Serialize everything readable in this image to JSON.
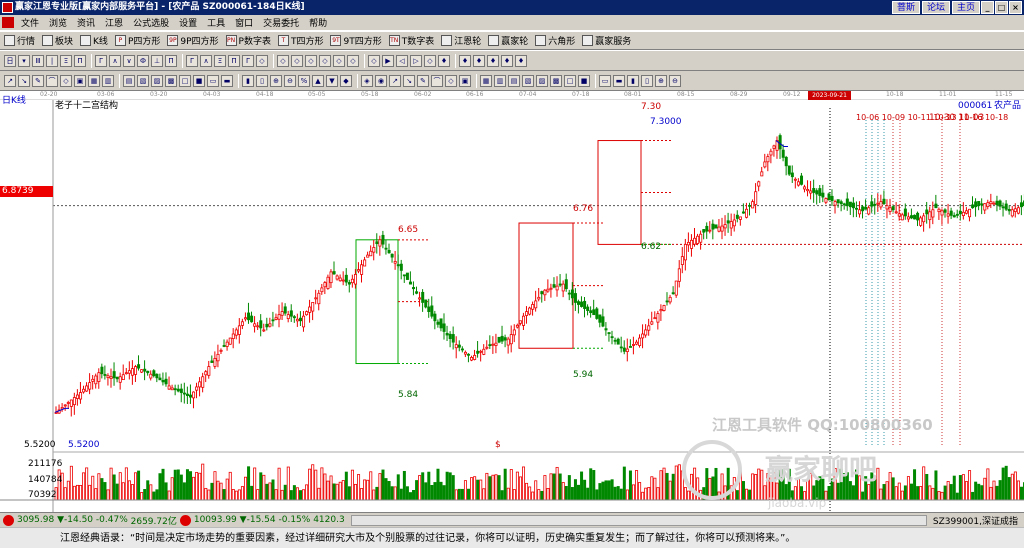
{
  "window": {
    "title": "赢家江恩专业版[赢家内部服务平台] - [农产品  SZ000061-184日K线]",
    "links": [
      "菩斯",
      "论坛",
      "主页"
    ]
  },
  "menu": [
    "文件",
    "浏览",
    "资讯",
    "江恩",
    "公式选股",
    "设置",
    "工具",
    "窗口",
    "交易委托",
    "帮助"
  ],
  "toolbar1": [
    {
      "icon": "list-icon",
      "label": "行情"
    },
    {
      "icon": "block-icon",
      "label": "板块"
    },
    {
      "icon": "kline-icon",
      "label": "K线"
    },
    {
      "icon": "P",
      "label": "P四方形"
    },
    {
      "icon": "9P",
      "label": "9P四方形"
    },
    {
      "icon": "PN",
      "label": "P数字表"
    },
    {
      "icon": "T",
      "label": "T四方形"
    },
    {
      "icon": "9T",
      "label": "9T四方形"
    },
    {
      "icon": "TN",
      "label": "T数字表"
    },
    {
      "icon": "wheel-icon",
      "label": "江恩轮"
    },
    {
      "icon": "wheel2-icon",
      "label": "赢家轮"
    },
    {
      "icon": "hex-icon",
      "label": "六角形"
    },
    {
      "icon": "service-icon",
      "label": "赢家服务"
    }
  ],
  "dates": [
    {
      "x": 40,
      "t": "02-20"
    },
    {
      "x": 97,
      "t": "03-06"
    },
    {
      "x": 150,
      "t": "03-20"
    },
    {
      "x": 203,
      "t": "04-03"
    },
    {
      "x": 256,
      "t": "04-18"
    },
    {
      "x": 308,
      "t": "05-05"
    },
    {
      "x": 361,
      "t": "05-18"
    },
    {
      "x": 414,
      "t": "06-02"
    },
    {
      "x": 466,
      "t": "06-16"
    },
    {
      "x": 519,
      "t": "07-04"
    },
    {
      "x": 572,
      "t": "07-18"
    },
    {
      "x": 624,
      "t": "08-01"
    },
    {
      "x": 677,
      "t": "08-15"
    },
    {
      "x": 730,
      "t": "08-29"
    },
    {
      "x": 783,
      "t": "09-12"
    },
    {
      "x": 886,
      "t": "10-18"
    },
    {
      "x": 939,
      "t": "11-01"
    },
    {
      "x": 995,
      "t": "11-15"
    }
  ],
  "highlight_date": "2023-09-21",
  "chart_labels": {
    "period": "日K线",
    "structure": "老子十二宫结构",
    "code": "000061",
    "name": "农产品",
    "price_box": "6.8739",
    "ytick": "5.5200",
    "low_marker": "5.5200",
    "peak_marker": "7.3000",
    "box1_top": "6.65",
    "box1_bot": "5.84",
    "box2_top": "6.76",
    "box2_bot": "5.94",
    "box3_top": "7.30",
    "box3_bot": "6.62",
    "future_dates": "10-06 10-09 10-11 10-13 10-16 10-18",
    "future_dates2": "10-30 11-03",
    "dollar_mark": "$",
    "vol_ticks": [
      "211176",
      "140784",
      "70392"
    ]
  },
  "watermark": {
    "line1": "江恩工具软件  QQ:100800360",
    "line2": "赢家聊吧",
    "line3": "jiaoba.vip"
  },
  "statusbar": {
    "sh_index": "3095.98",
    "sh_chg": "▼-14.50",
    "sh_pct": "-0.47%",
    "sh_amt": "2659.72亿",
    "sz_index": "10093.99",
    "sz_chg": "▼-15.54",
    "sz_pct": "-0.15%",
    "sz_amt": "4120.3",
    "right": "SZ399001,深证成指"
  },
  "quote": "江恩经典语录：“时间是决定市场走势的重要因素，经过详细研究大市及个别股票的过往记录，你将可以证明，历史确实重复发生；而了解过往，你将可以预测将来。”。",
  "chart_data": {
    "type": "candlestick",
    "symbol": "SZ000061",
    "name": "农产品",
    "period": "daily",
    "ylim": [
      5.3,
      7.5
    ],
    "horizontal_lines": [
      6.8739,
      6.62
    ],
    "price_boxes": [
      {
        "top": 6.65,
        "bottom": 5.84
      },
      {
        "top": 6.76,
        "bottom": 5.94
      },
      {
        "top": 7.3,
        "bottom": 6.62
      }
    ],
    "close_path": [
      [
        0,
        5.52
      ],
      [
        8,
        5.65
      ],
      [
        14,
        5.78
      ],
      [
        20,
        5.74
      ],
      [
        26,
        5.82
      ],
      [
        32,
        5.76
      ],
      [
        38,
        5.68
      ],
      [
        44,
        5.62
      ],
      [
        50,
        5.82
      ],
      [
        56,
        5.98
      ],
      [
        62,
        6.14
      ],
      [
        68,
        6.06
      ],
      [
        74,
        6.18
      ],
      [
        80,
        6.12
      ],
      [
        86,
        6.3
      ],
      [
        90,
        6.44
      ],
      [
        96,
        6.36
      ],
      [
        102,
        6.55
      ],
      [
        106,
        6.65
      ],
      [
        112,
        6.48
      ],
      [
        118,
        6.3
      ],
      [
        124,
        6.12
      ],
      [
        130,
        5.98
      ],
      [
        136,
        5.88
      ],
      [
        142,
        5.96
      ],
      [
        148,
        6.0
      ],
      [
        154,
        6.18
      ],
      [
        160,
        6.32
      ],
      [
        166,
        6.36
      ],
      [
        170,
        6.24
      ],
      [
        176,
        6.16
      ],
      [
        180,
        6.06
      ],
      [
        186,
        5.92
      ],
      [
        190,
        5.98
      ],
      [
        196,
        6.14
      ],
      [
        202,
        6.3
      ],
      [
        206,
        6.62
      ],
      [
        212,
        6.7
      ],
      [
        218,
        6.74
      ],
      [
        224,
        6.8
      ],
      [
        228,
        6.9
      ],
      [
        232,
        7.16
      ],
      [
        236,
        7.3
      ],
      [
        240,
        7.08
      ],
      [
        246,
        6.98
      ],
      [
        252,
        6.92
      ],
      [
        258,
        6.88
      ],
      [
        264,
        6.84
      ],
      [
        270,
        6.9
      ],
      [
        276,
        6.82
      ],
      [
        282,
        6.78
      ],
      [
        288,
        6.86
      ],
      [
        294,
        6.8
      ],
      [
        300,
        6.86
      ],
      [
        306,
        6.9
      ],
      [
        312,
        6.84
      ],
      [
        318,
        6.88
      ],
      [
        324,
        6.92
      ],
      [
        330,
        6.85
      ],
      [
        336,
        6.8
      ],
      [
        342,
        6.84
      ]
    ],
    "volume_ticks": [
      211176,
      140784,
      70392
    ]
  }
}
